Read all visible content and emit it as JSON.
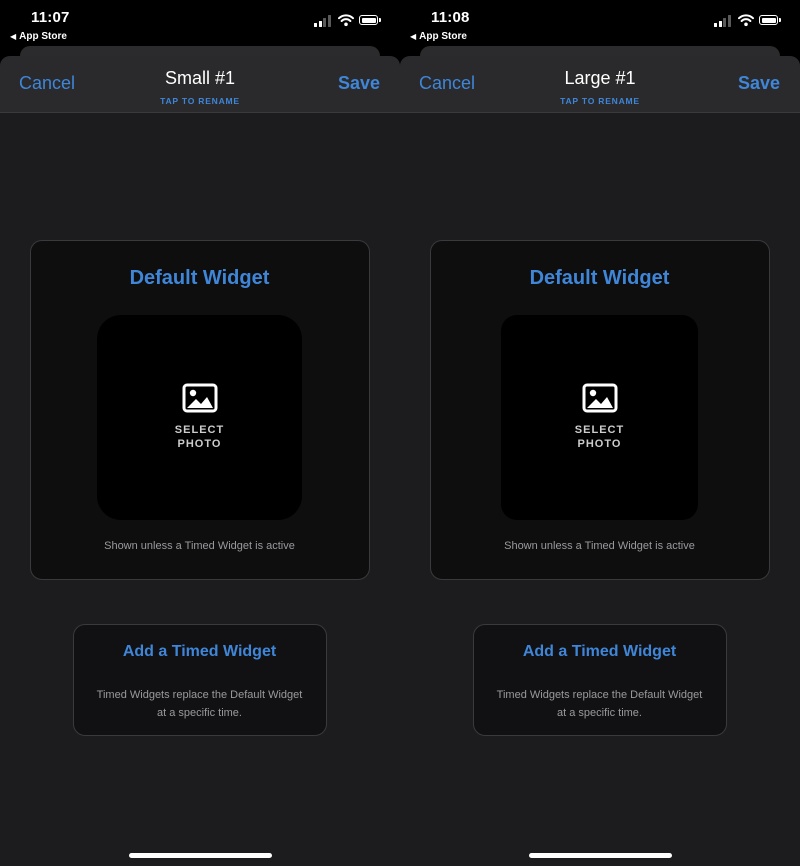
{
  "screens": [
    {
      "status": {
        "time": "11:07",
        "back_app": "App Store"
      },
      "nav": {
        "cancel": "Cancel",
        "title": "Small #1",
        "rename_hint": "TAP TO RENAME",
        "save": "Save"
      },
      "default_widget": {
        "title": "Default Widget",
        "photo_label_line1": "SELECT",
        "photo_label_line2": "PHOTO",
        "caption": "Shown unless a Timed Widget is active"
      },
      "timed_widget": {
        "title": "Add a Timed Widget",
        "description": "Timed Widgets replace the Default Widget at a specific time."
      }
    },
    {
      "status": {
        "time": "11:08",
        "back_app": "App Store"
      },
      "nav": {
        "cancel": "Cancel",
        "title": "Large #1",
        "rename_hint": "TAP TO RENAME",
        "save": "Save"
      },
      "default_widget": {
        "title": "Default Widget",
        "photo_label_line1": "SELECT",
        "photo_label_line2": "PHOTO",
        "caption": "Shown unless a Timed Widget is active"
      },
      "timed_widget": {
        "title": "Add a Timed Widget",
        "description": "Timed Widgets replace the Default Widget at a specific time."
      }
    }
  ],
  "colors": {
    "accent": "#3f86d8",
    "sheet_bg": "#1c1c1e",
    "card_bg": "#0e0e0f"
  },
  "icons": [
    "signal-icon",
    "wifi-icon",
    "battery-icon",
    "back-triangle-icon",
    "photo-icon"
  ]
}
